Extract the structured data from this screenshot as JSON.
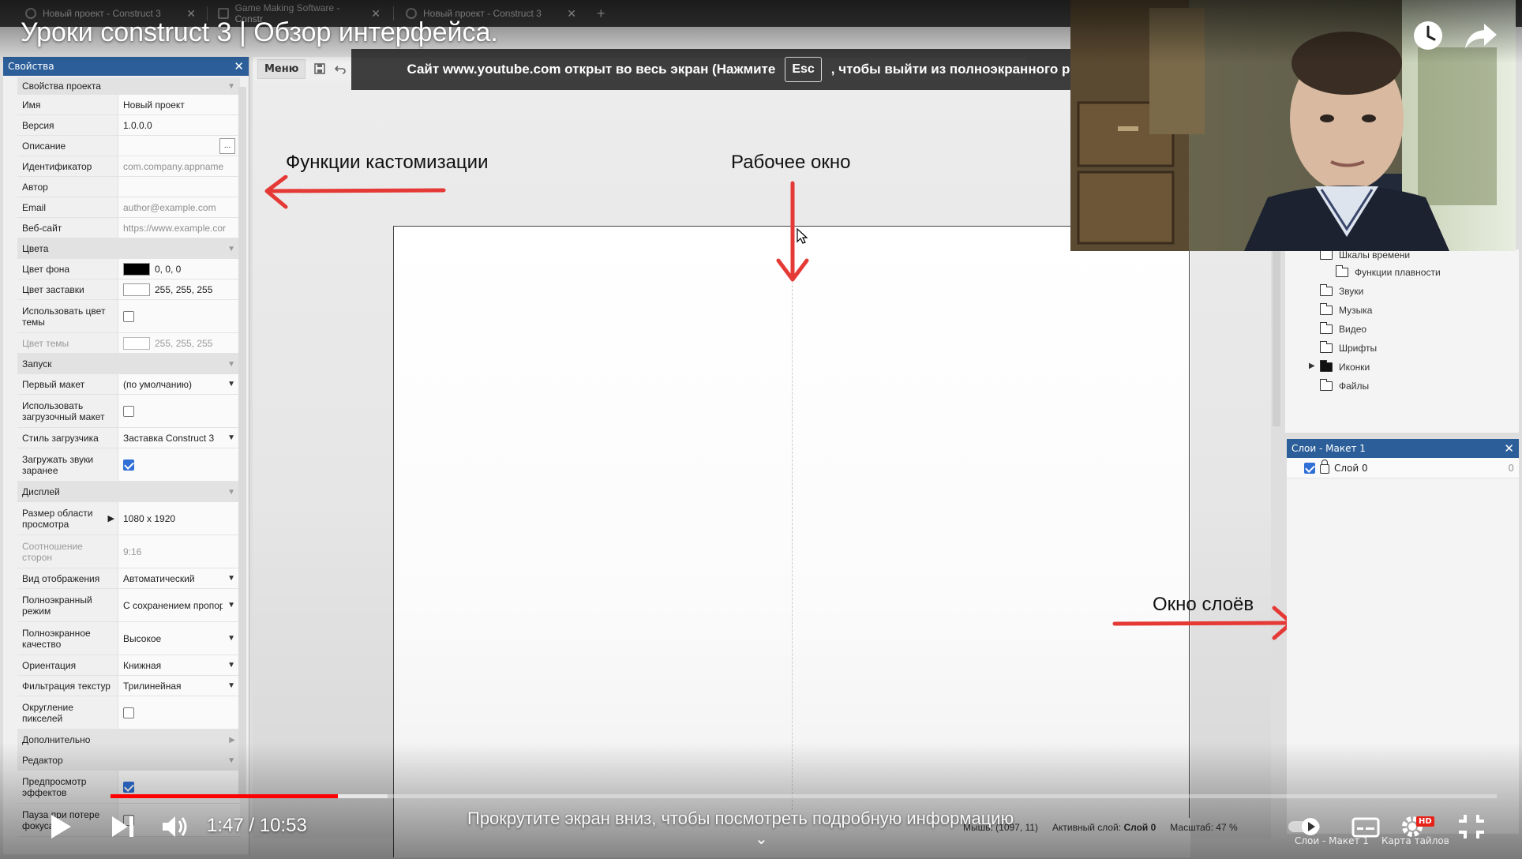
{
  "browser": {
    "tabs": [
      {
        "title": "Новый проект - Construct 3"
      },
      {
        "title": "Game Making Software - Constr"
      },
      {
        "title": "Новый проект - Construct 3"
      }
    ],
    "new_tab_symbol": "+"
  },
  "video": {
    "title": "Уроки construct 3 | Обзор интерфейса.",
    "time_current": "1:47",
    "time_separator": " / ",
    "time_total": "10:53",
    "progress_fraction": 0.164,
    "buffered_fraction": 0.2,
    "scroll_hint": "Прокрутите экран вниз, чтобы посмотреть подробную информацию",
    "hd_badge": "HD"
  },
  "fullscreen_notice": {
    "before": "Сайт www.youtube.com открыт во весь экран (Нажмите",
    "key": "Esc",
    "after": ", чтобы выйти из полноэкранного режима)"
  },
  "properties_panel": {
    "title": "Свойства",
    "sections": {
      "project": "Свойства проекта",
      "colors": "Цвета",
      "startup": "Запуск",
      "display": "Дисплей",
      "advanced": "Дополнительно",
      "editor": "Редактор"
    },
    "rows": {
      "name": {
        "label": "Имя",
        "value": "Новый проект"
      },
      "version": {
        "label": "Версия",
        "value": "1.0.0.0"
      },
      "description": {
        "label": "Описание",
        "value": "",
        "button": "..."
      },
      "id": {
        "label": "Идентификатор",
        "value": "com.company.appname"
      },
      "author": {
        "label": "Автор",
        "value": ""
      },
      "email": {
        "label": "Email",
        "value": "author@example.com"
      },
      "website": {
        "label": "Веб-сайт",
        "value": "https://www.example.cor"
      },
      "bg_color": {
        "label": "Цвет фона",
        "value": "0, 0, 0",
        "swatch": "#000000"
      },
      "splash_color": {
        "label": "Цвет заставки",
        "value": "255, 255, 255",
        "swatch": "#ffffff"
      },
      "use_theme_color": {
        "label": "Использовать цвет темы",
        "checked": false
      },
      "theme_color": {
        "label": "Цвет темы",
        "value": "255, 255, 255",
        "swatch": "#ffffff"
      },
      "first_layout": {
        "label": "Первый макет",
        "value": "(по умолчанию)"
      },
      "use_loader_layout": {
        "label": "Использовать загрузочный макет",
        "checked": false
      },
      "loader_style": {
        "label": "Стиль загрузчика",
        "value": "Заставка Construct 3"
      },
      "preload_sounds": {
        "label": "Загружать звуки заранее",
        "checked": true
      },
      "viewport_size": {
        "label": "Размер области просмотра",
        "value": "1080 x 1920"
      },
      "aspect_ratio": {
        "label": "Соотношение сторон",
        "value": "9:16"
      },
      "display_mode": {
        "label": "Вид отображения",
        "value": "Автоматический"
      },
      "fullscreen_mode": {
        "label": "Полноэкранный режим",
        "value": "С сохранением пропорций"
      },
      "fullscreen_quality": {
        "label": "Полноэкранное качество",
        "value": "Высокое"
      },
      "orientation": {
        "label": "Ориентация",
        "value": "Книжная"
      },
      "texture_filter": {
        "label": "Фильтрация текстур",
        "value": "Трилинейная"
      },
      "pixel_rounding": {
        "label": "Округление пикселей",
        "checked": false
      },
      "preview_effects": {
        "label": "Предпросмотр эффектов",
        "checked": true
      },
      "pause_on_unfocus": {
        "label": "Пауза при потере фокуса",
        "checked": false
      }
    }
  },
  "toolbar": {
    "menu_label": "Меню"
  },
  "annotations": {
    "customization": "Функции кастомизации",
    "work_window": "Рабочее окно",
    "layers_window": "Окно слоёв",
    "arrow_color": "#e53935"
  },
  "project_tree": {
    "items": [
      {
        "label": "Шкалы времени",
        "filled": false
      },
      {
        "label": "Функции плавности",
        "filled": false
      },
      {
        "label": "Звуки",
        "filled": false
      },
      {
        "label": "Музыка",
        "filled": false
      },
      {
        "label": "Видео",
        "filled": false
      },
      {
        "label": "Шрифты",
        "filled": false
      },
      {
        "label": "Иконки",
        "filled": true
      },
      {
        "label": "Файлы",
        "filled": false
      }
    ]
  },
  "layers_panel": {
    "title": "Слои - Макет 1",
    "layer": {
      "name": "Слой 0",
      "count": "0",
      "visible": true
    }
  },
  "statusbar": {
    "mouse": "Мышь: (1097, 11)",
    "active_layer_label": "Активный слой:",
    "active_layer_value": "Слой 0",
    "zoom": "Масштаб: 47 %"
  },
  "bottom_tabs": {
    "layers_tab": "Слои - Макет 1",
    "tilemap_tab": "Карта тайлов"
  },
  "colors": {
    "panel_header": "#2c5f99",
    "progress_red": "#ff0000"
  }
}
